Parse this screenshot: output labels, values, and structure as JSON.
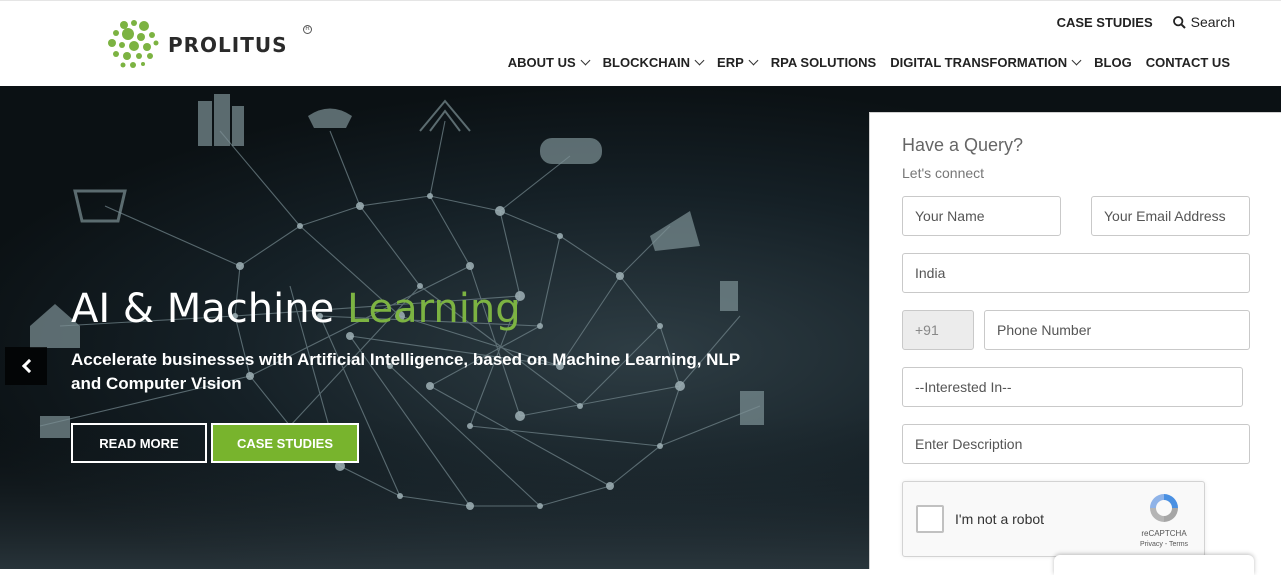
{
  "brand": {
    "name": "PROLITUS",
    "registered_mark": "R",
    "accent_color": "#7cb342"
  },
  "top_links": {
    "case_studies": "CASE STUDIES",
    "search": "Search"
  },
  "nav": {
    "items": [
      {
        "label": "ABOUT US",
        "dropdown": true
      },
      {
        "label": "BLOCKCHAIN",
        "dropdown": true
      },
      {
        "label": "ERP",
        "dropdown": true
      },
      {
        "label": "RPA SOLUTIONS",
        "dropdown": false
      },
      {
        "label": "DIGITAL TRANSFORMATION",
        "dropdown": true
      },
      {
        "label": "BLOG",
        "dropdown": false
      },
      {
        "label": "CONTACT US",
        "dropdown": false
      }
    ]
  },
  "hero": {
    "title_main": "AI & Machine ",
    "title_accent": "Learning",
    "subtitle": "Accelerate businesses with Artificial Intelligence, based on Machine Learning, NLP and Computer Vision",
    "read_more": "READ MORE",
    "case_studies": "CASE STUDIES"
  },
  "query_form": {
    "title": "Have a Query?",
    "subtitle": "Let's connect",
    "name_placeholder": "Your Name",
    "email_placeholder": "Your Email Address",
    "country_value": "India",
    "phone_code": "+91",
    "phone_placeholder": "Phone Number",
    "interested_in": "--Interested In--",
    "description_placeholder": "Enter Description",
    "recaptcha": {
      "label": "I'm not a robot",
      "brand": "reCAPTCHA",
      "links": "Privacy - Terms"
    }
  }
}
